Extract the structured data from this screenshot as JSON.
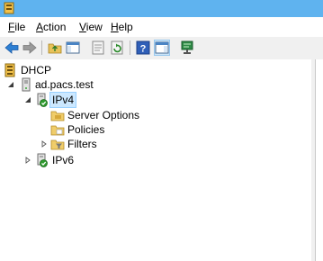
{
  "menu": {
    "file": {
      "u": "F",
      "rest": "ile"
    },
    "action": {
      "u": "A",
      "rest": "ction"
    },
    "view": {
      "u": "V",
      "rest": "iew"
    },
    "help": {
      "u": "H",
      "rest": "elp"
    }
  },
  "tree": {
    "root": "DHCP",
    "server": "ad.pacs.test",
    "ipv4": "IPv4",
    "server_options": "Server Options",
    "policies": "Policies",
    "filters": "Filters",
    "ipv6": "IPv6"
  },
  "colors": {
    "titlebar": "#5fb3ef",
    "selection": "#cce8ff"
  },
  "icons": {
    "app": "dhcp-app-icon",
    "back": "back-arrow-icon",
    "forward": "forward-arrow-icon"
  }
}
